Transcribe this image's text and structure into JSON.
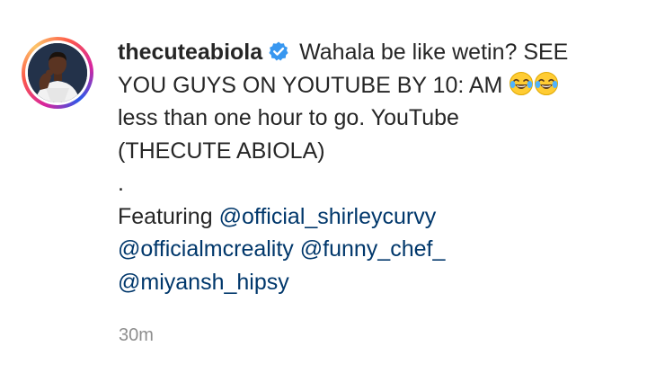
{
  "post": {
    "username": "thecuteabiola",
    "verified": true,
    "caption": {
      "line1": "Wahala be like wetin? SEE",
      "line2": "YOU GUYS ON YOUTUBE BY 10: AM",
      "line3": "less than one hour to go. YouTube",
      "line4": "(THECUTE ABIOLA)",
      "dot": ".",
      "featuring_label": "Featuring",
      "mentions": [
        "@official_shirleycurvy",
        "@officialmcreality",
        "@funny_chef_",
        "@miyansh_hipsy"
      ]
    },
    "emoji": [
      "face-with-tears-of-joy",
      "face-with-tears-of-joy"
    ],
    "timestamp": "30m"
  },
  "colors": {
    "text": "#262626",
    "mention": "#00376b",
    "timestamp": "#8e8e8e",
    "verified": "#3897f0"
  }
}
